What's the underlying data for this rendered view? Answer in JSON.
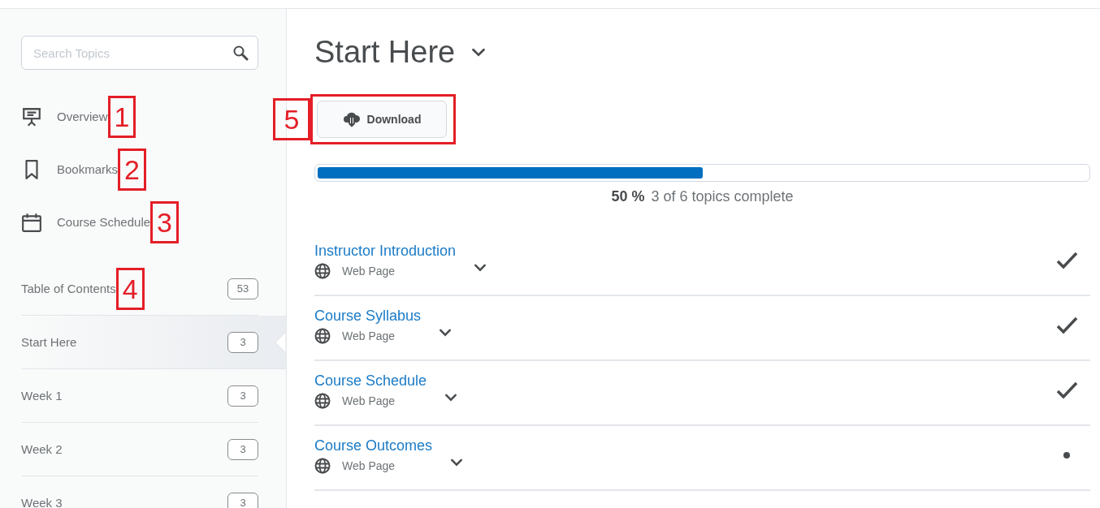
{
  "sidebar": {
    "search": {
      "placeholder": "Search Topics"
    },
    "links": [
      {
        "kind": "overview",
        "label": "Overview",
        "callout": "1"
      },
      {
        "kind": "bookmarks",
        "label": "Bookmarks",
        "callout": "2"
      },
      {
        "kind": "schedule",
        "label": "Course Schedule",
        "callout": "3"
      }
    ],
    "modules": [
      {
        "label": "Table of Contents",
        "count": "53",
        "selected": false,
        "callout": "4"
      },
      {
        "label": "Start Here",
        "count": "3",
        "selected": true
      },
      {
        "label": "Week 1",
        "count": "3",
        "selected": false
      },
      {
        "label": "Week 2",
        "count": "3",
        "selected": false
      },
      {
        "label": "Week 3",
        "count": "3",
        "selected": false
      }
    ]
  },
  "main": {
    "title": "Start Here",
    "download": {
      "label": "Download",
      "callout": "5"
    },
    "progress": {
      "level": 0.5,
      "percent": "50 %",
      "summary": "3 of 6 topics complete"
    },
    "topics": [
      {
        "title": "Instructor Introduction",
        "type": "Web Page",
        "completed": true
      },
      {
        "title": "Course Syllabus",
        "type": "Web Page",
        "completed": true
      },
      {
        "title": "Course Schedule",
        "type": "Web Page",
        "completed": true
      },
      {
        "title": "Course Outcomes",
        "type": "Web Page",
        "completed": false
      }
    ]
  }
}
